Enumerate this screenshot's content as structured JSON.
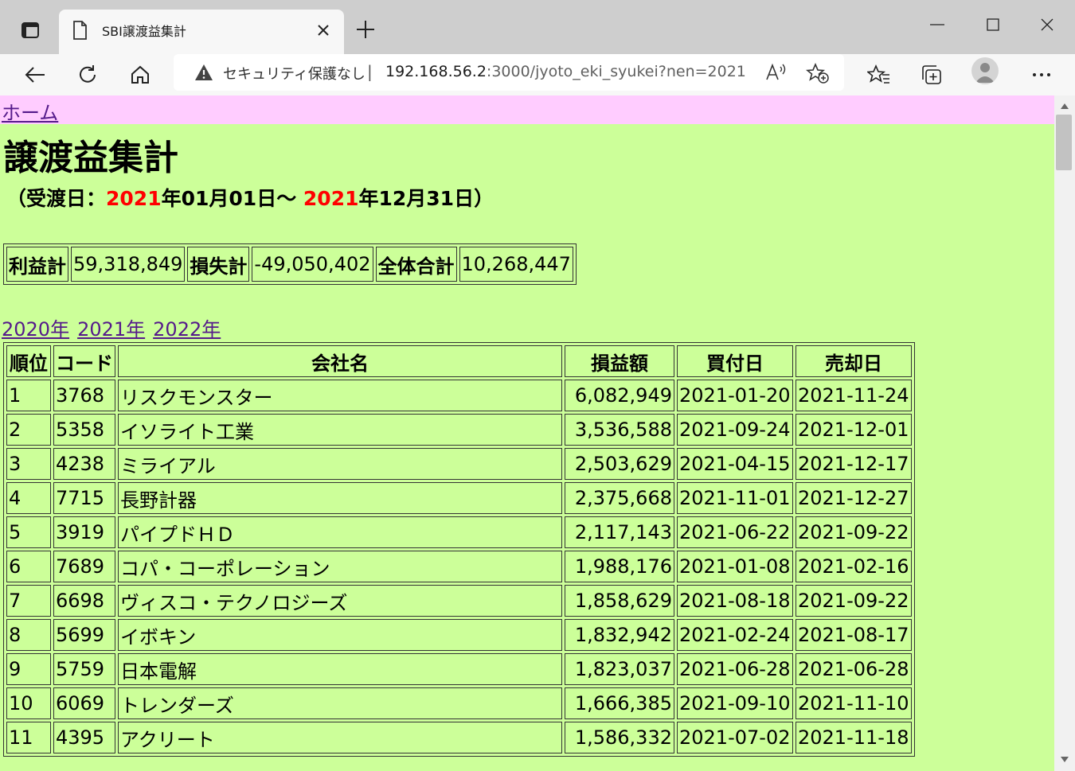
{
  "browser": {
    "tab_title": "SBI譲渡益集計",
    "security_label": "セキュリティ保護なし",
    "url_host": "192.168.56.2",
    "url_rest": ":3000/jyoto_eki_syukei?nen=2021"
  },
  "page": {
    "home_link": "ホーム",
    "title": "譲渡益集計",
    "period": {
      "prefix": "（受渡日：",
      "start_year": "2021",
      "start_rest": "年01月01日～ ",
      "end_year": "2021",
      "end_rest": "年12月31日）"
    },
    "summary": {
      "profit_label": "利益計",
      "profit_value": "59,318,849",
      "loss_label": "損失計",
      "loss_value": "-49,050,402",
      "total_label": "全体合計",
      "total_value": "10,268,447"
    },
    "year_links": [
      "2020年",
      "2021年",
      "2022年"
    ],
    "table": {
      "headers": [
        "順位",
        "コード",
        "会社名",
        "損益額",
        "買付日",
        "売却日"
      ],
      "rows": [
        [
          "1",
          "3768",
          "リスクモンスター",
          "6,082,949",
          "2021-01-20",
          "2021-11-24"
        ],
        [
          "2",
          "5358",
          "イソライト工業",
          "3,536,588",
          "2021-09-24",
          "2021-12-01"
        ],
        [
          "3",
          "4238",
          "ミライアル",
          "2,503,629",
          "2021-04-15",
          "2021-12-17"
        ],
        [
          "4",
          "7715",
          "長野計器",
          "2,375,668",
          "2021-11-01",
          "2021-12-27"
        ],
        [
          "5",
          "3919",
          "パイプドＨＤ",
          "2,117,143",
          "2021-06-22",
          "2021-09-22"
        ],
        [
          "6",
          "7689",
          "コパ・コーポレーション",
          "1,988,176",
          "2021-01-08",
          "2021-02-16"
        ],
        [
          "7",
          "6698",
          "ヴィスコ・テクノロジーズ",
          "1,858,629",
          "2021-08-18",
          "2021-09-22"
        ],
        [
          "8",
          "5699",
          "イボキン",
          "1,832,942",
          "2021-02-24",
          "2021-08-17"
        ],
        [
          "9",
          "5759",
          "日本電解",
          "1,823,037",
          "2021-06-28",
          "2021-06-28"
        ],
        [
          "10",
          "6069",
          "トレンダーズ",
          "1,666,385",
          "2021-09-10",
          "2021-11-10"
        ],
        [
          "11",
          "4395",
          "アクリート",
          "1,586,332",
          "2021-07-02",
          "2021-11-18"
        ]
      ]
    }
  },
  "colors": {
    "page_bg": "#ccff99",
    "home_bar_bg": "#ffccff",
    "year_highlight": "#ff0000",
    "link": "#551a8b"
  }
}
